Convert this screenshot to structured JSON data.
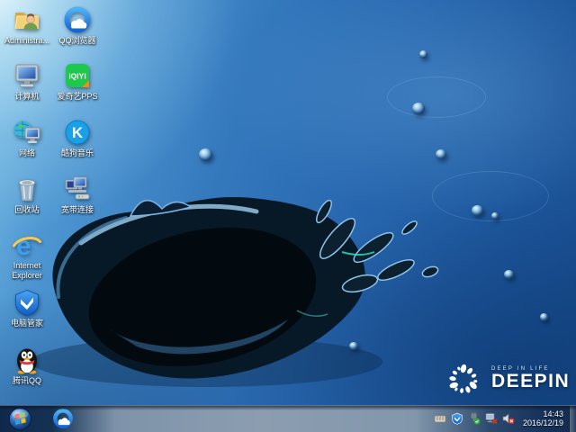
{
  "wallpaper": {
    "brand": "DEEPIN",
    "slogan": "DEEP IN LIFE"
  },
  "desktop": {
    "icons": [
      {
        "name": "administrator-folder",
        "label": "Administra..."
      },
      {
        "name": "qq-browser",
        "label": "QQ浏览器"
      },
      {
        "name": "computer",
        "label": "计算机"
      },
      {
        "name": "iqiyi-pps",
        "label": "爱奇艺PPS",
        "icon_text": "iQIYI"
      },
      {
        "name": "network",
        "label": "网络"
      },
      {
        "name": "kugou-music",
        "label": "酷狗音乐",
        "icon_text": "K"
      },
      {
        "name": "recycle-bin",
        "label": "回收站"
      },
      {
        "name": "broadband-connection",
        "label": "宽带连接"
      },
      {
        "name": "internet-explorer",
        "label": "Internet Explorer",
        "icon_text": "e"
      },
      {
        "name": "pc-manager",
        "label": "电脑管家"
      },
      {
        "name": "tencent-qq",
        "label": "腾讯QQ"
      }
    ]
  },
  "taskbar": {
    "tray": {
      "time": "14:43",
      "date": "2016/12/19"
    },
    "tray_icons": [
      "input-indicator",
      "security-shield",
      "hardware-safely-remove",
      "network-disconnected",
      "volume-muted"
    ]
  },
  "colors": {
    "iqiyi_green": "#1dc94c",
    "kugou_blue": "#1aa0e8",
    "shield_blue": "#2a7de0",
    "qq_scarf_red": "#e23b3b",
    "taskbar_gray": "#8c9db0",
    "taskbar_navy": "#143154"
  }
}
